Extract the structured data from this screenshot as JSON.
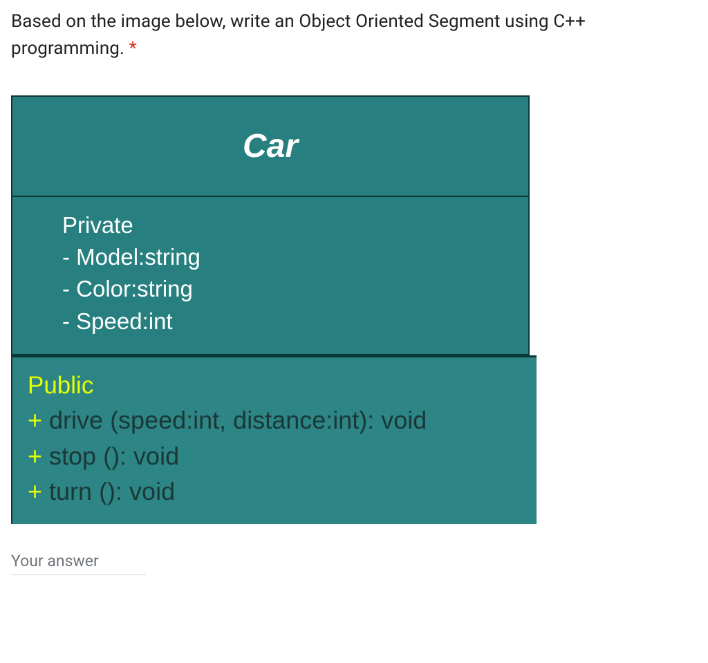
{
  "question": {
    "text": "Based on the image below, write an Object Oriented Segment using C++ programming.",
    "required_marker": "*"
  },
  "uml": {
    "class_name": "Car",
    "private_label": "Private",
    "private_attrs": {
      "a1": "- Model:string",
      "a2": "- Color:string",
      "a3": "- Speed:int"
    },
    "public_label": "Public",
    "public_methods": {
      "m1_plus": "+",
      "m1": " drive (speed:int, distance:int): void",
      "m2_plus": "+",
      "m2": " stop (): void",
      "m3_plus": "+",
      "m3": " turn (): void"
    }
  },
  "answer": {
    "placeholder": "Your answer"
  }
}
